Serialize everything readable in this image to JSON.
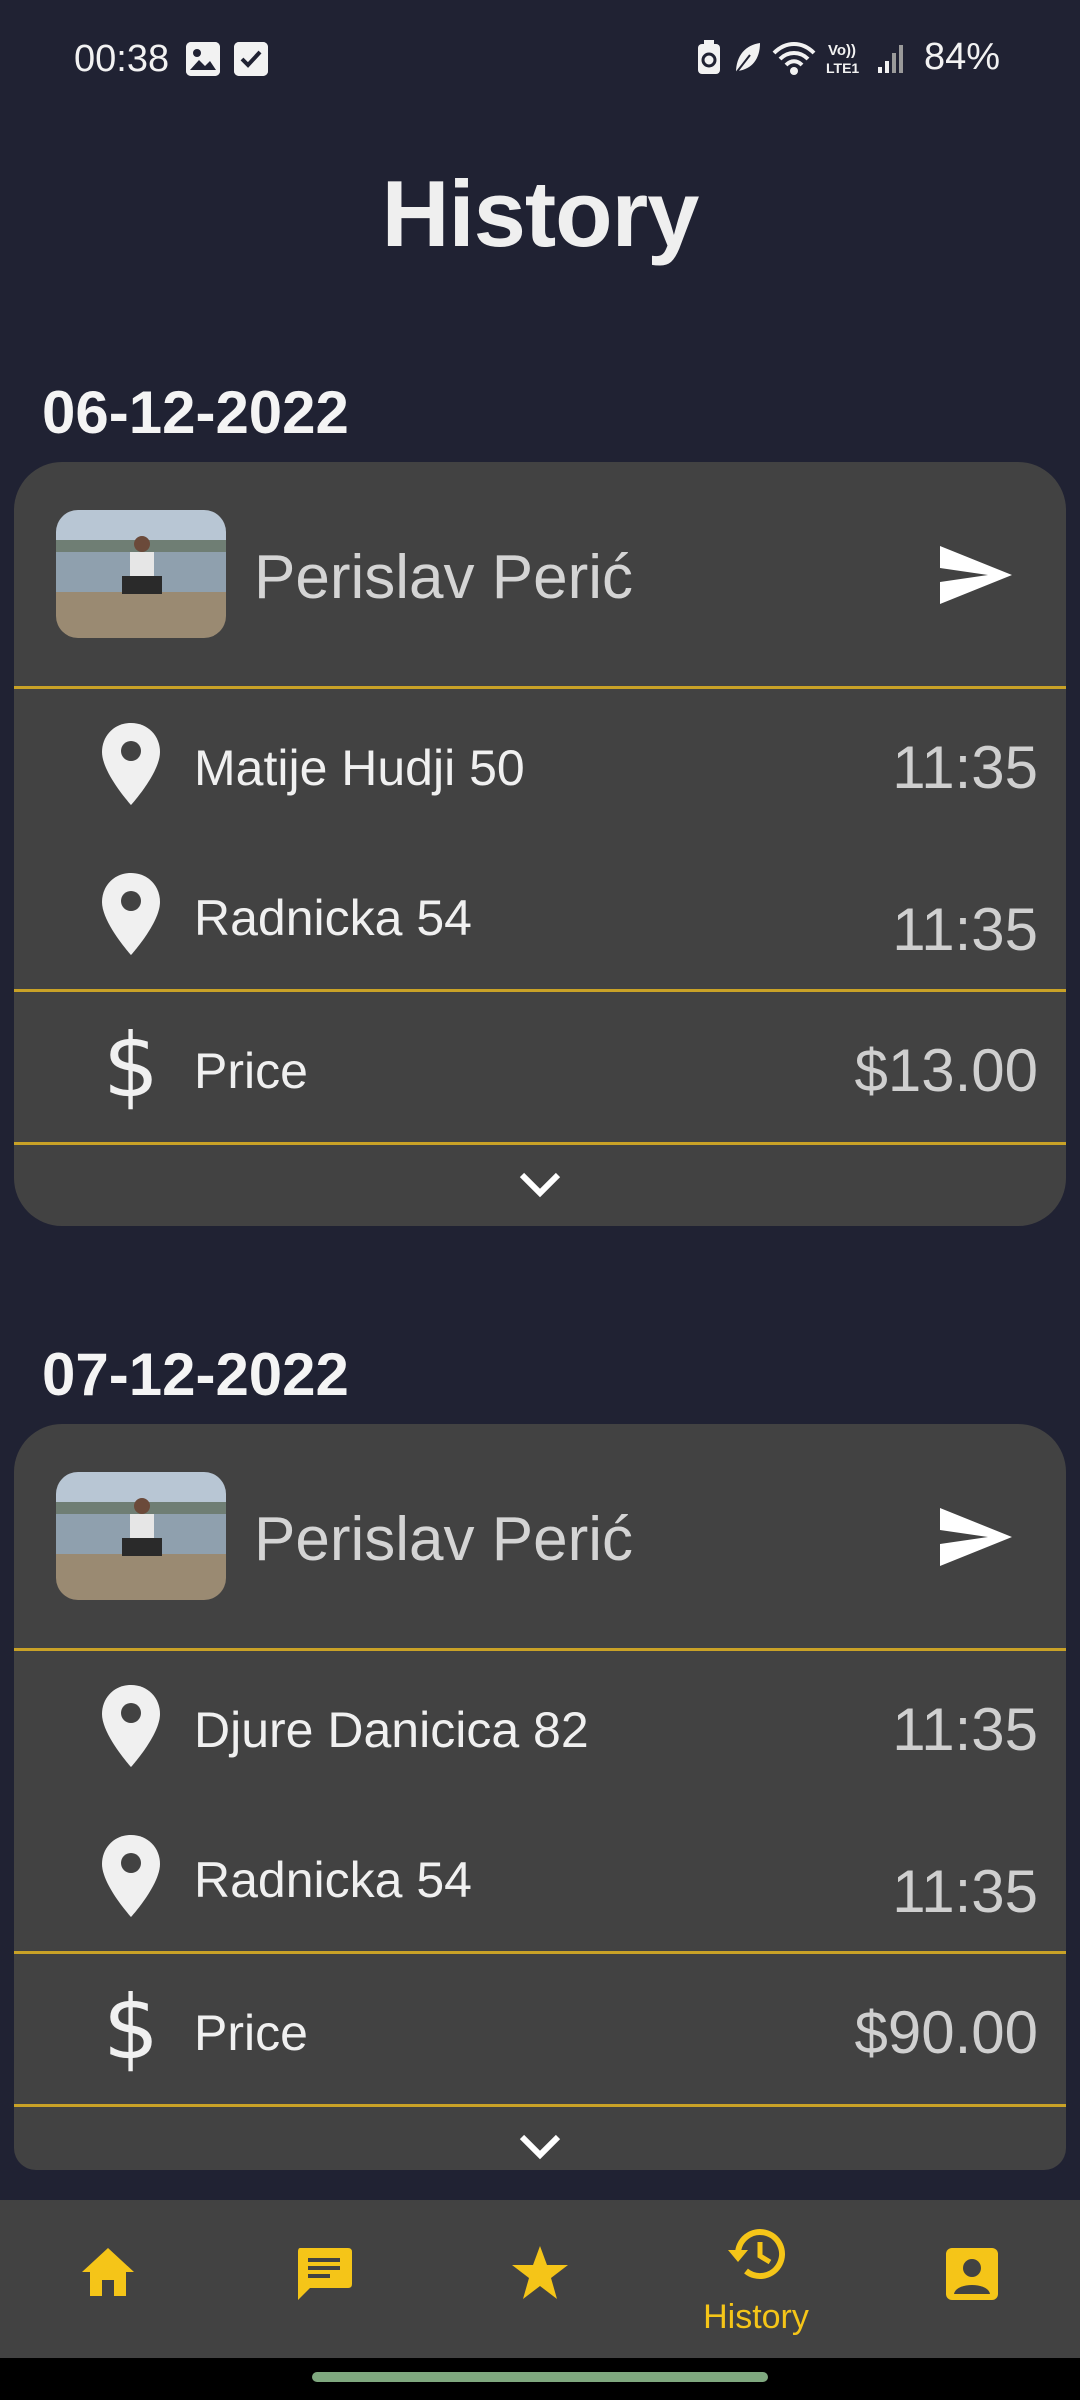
{
  "status_bar": {
    "time": "00:38",
    "battery": "84%",
    "network": "Vo)) LTE1"
  },
  "page": {
    "title": "History"
  },
  "rides": [
    {
      "date": "06-12-2022",
      "driver": "Perislav Perić",
      "pickup": {
        "address": "Matije Hudji 50",
        "time": "11:35"
      },
      "dropoff": {
        "address": "Radnicka 54",
        "time": "11:35"
      },
      "price_label": "Price",
      "price": "$13.00"
    },
    {
      "date": "07-12-2022",
      "driver": "Perislav Perić",
      "pickup": {
        "address": "Djure Danicica 82",
        "time": "11:35"
      },
      "dropoff": {
        "address": "Radnicka 54",
        "time": "11:35"
      },
      "price_label": "Price",
      "price": "$90.00"
    }
  ],
  "nav": {
    "items": [
      {
        "icon": "home-icon"
      },
      {
        "icon": "chat-icon"
      },
      {
        "icon": "star-icon"
      },
      {
        "icon": "history-icon",
        "label": "History",
        "active": true
      },
      {
        "icon": "account-icon"
      }
    ],
    "accent": "#f5c518"
  },
  "colors": {
    "background": "#202233",
    "card": "#424242",
    "divider": "#c9a227",
    "accent": "#f5c518"
  }
}
